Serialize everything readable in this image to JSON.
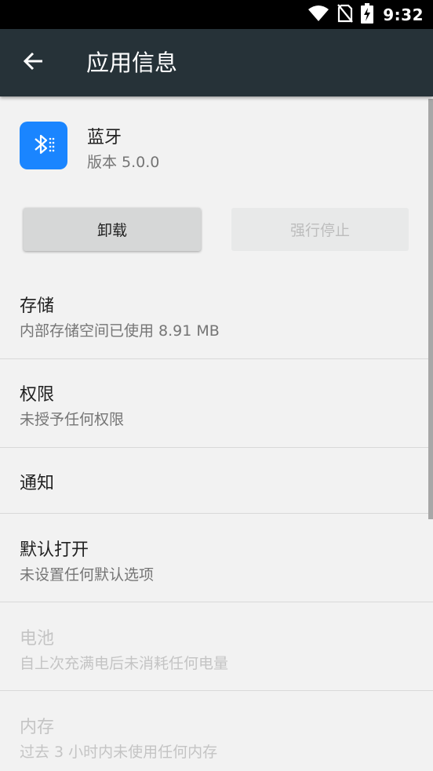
{
  "status_bar": {
    "time": "9:32",
    "icons": [
      "wifi-icon",
      "no-sim-icon",
      "battery-charging-icon"
    ]
  },
  "app_bar": {
    "back_icon": "arrow-back-icon",
    "title": "应用信息",
    "background_color": "#263238"
  },
  "app": {
    "name": "蓝牙",
    "version": "版本 5.0.0",
    "icon": "bluetooth-icon",
    "icon_color": "#1a85ff"
  },
  "buttons": {
    "uninstall": "卸载",
    "force_stop": "强行停止"
  },
  "items": [
    {
      "title": "存储",
      "subtitle": "内部存储空间已使用 8.91 MB",
      "enabled": true
    },
    {
      "title": "权限",
      "subtitle": "未授予任何权限",
      "enabled": true
    },
    {
      "title": "通知",
      "subtitle": "",
      "enabled": true
    },
    {
      "title": "默认打开",
      "subtitle": "未设置任何默认选项",
      "enabled": true
    },
    {
      "title": "电池",
      "subtitle": "自上次充满电后未消耗任何电量",
      "enabled": false
    },
    {
      "title": "内存",
      "subtitle": "过去 3 小时内未使用任何内存",
      "enabled": false
    }
  ]
}
